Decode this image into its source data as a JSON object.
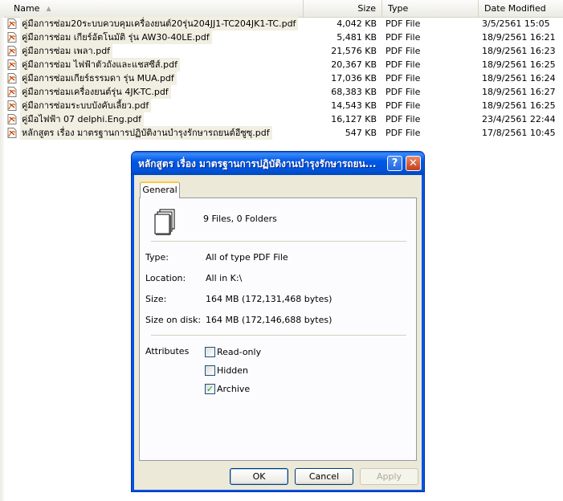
{
  "columns": {
    "name": "Name",
    "size": "Size",
    "type": "Type",
    "date": "Date Modified"
  },
  "files": [
    {
      "name": "คู่มือการซ่อม20ระบบควบคุมเครื่องยนต์20รุ่น204JJ1-TC204JK1-TC.pdf",
      "size": "4,042 KB",
      "type": "PDF File",
      "date": "3/5/2561 15:05"
    },
    {
      "name": "คู่มือการซ่อม เกียร์อัตโนมัติ รุ่น AW30-40LE.pdf",
      "size": "5,481 KB",
      "type": "PDF File",
      "date": "18/9/2561 16:21"
    },
    {
      "name": "คู่มือการซ่อม เพลา.pdf",
      "size": "21,576 KB",
      "type": "PDF File",
      "date": "18/9/2561 16:23"
    },
    {
      "name": "คู่มือการซ่อม ไฟฟ้าตัวถังและแชสซีส์.pdf",
      "size": "20,367 KB",
      "type": "PDF File",
      "date": "18/9/2561 16:25"
    },
    {
      "name": "คู่มือการซ่อมเกียร์ธรรมดา รุ่น MUA.pdf",
      "size": "17,036 KB",
      "type": "PDF File",
      "date": "18/9/2561 16:24"
    },
    {
      "name": "คู่มือการซ่อมเครื่องยนต์รุ่น 4JK-TC.pdf",
      "size": "68,383 KB",
      "type": "PDF File",
      "date": "18/9/2561 16:27"
    },
    {
      "name": "คู่มือการซ่อมระบบบังคับเลี้ยว.pdf",
      "size": "14,543 KB",
      "type": "PDF File",
      "date": "18/9/2561 16:25"
    },
    {
      "name": "คู่มือไฟฟ้า 07 delphi.Eng.pdf",
      "size": "16,127 KB",
      "type": "PDF File",
      "date": "23/4/2561 22:44"
    },
    {
      "name": "หลักสูตร เรื่อง มาตรฐานการปฏิบัติงานบำรุงรักษารถยนต์อีซูซุ.pdf",
      "size": "547 KB",
      "type": "PDF File",
      "date": "17/8/2561 10:45"
    }
  ],
  "dialog": {
    "title": "หลักสูตร เรื่อง มาตรฐานการปฏิบัติงานบำรุงรักษารถยน...",
    "help_label": "?",
    "close_label": "✕",
    "tab": "General",
    "summary": "9 Files, 0 Folders",
    "props": [
      {
        "label": "Type:",
        "value": "All of type PDF File"
      },
      {
        "label": "Location:",
        "value": "All in K:\\"
      },
      {
        "label": "Size:",
        "value": "164 MB (172,131,468 bytes)"
      },
      {
        "label": "Size on disk:",
        "value": "164 MB (172,146,688 bytes)"
      }
    ],
    "attributes_label": "Attributes",
    "attributes": [
      {
        "label": "Read-only",
        "checked": false
      },
      {
        "label": "Hidden",
        "checked": false
      },
      {
        "label": "Archive",
        "checked": true
      }
    ],
    "buttons": {
      "ok": "OK",
      "cancel": "Cancel",
      "apply": "Apply"
    }
  },
  "colors": {
    "title_bar": "#0054e3",
    "dialog_bg": "#ece9d8",
    "selection": "#f1efe2",
    "check": "#21a121"
  }
}
